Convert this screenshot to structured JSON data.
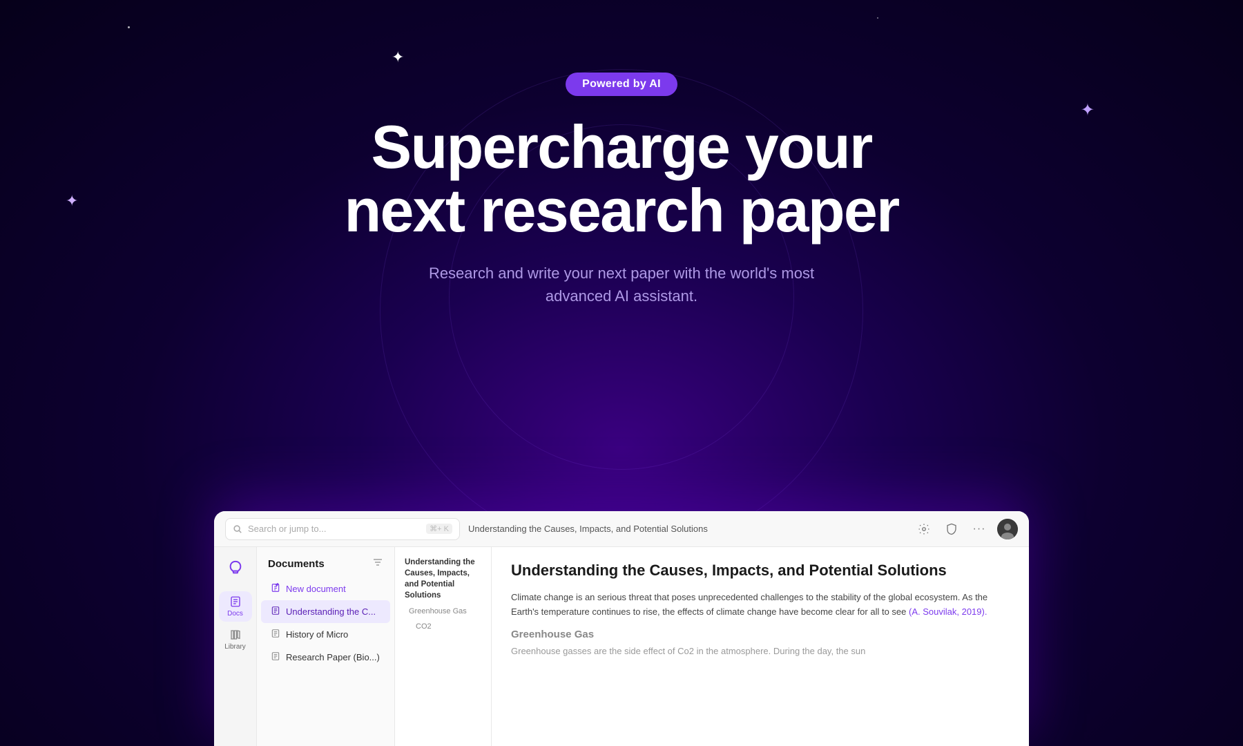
{
  "background": {
    "color": "#0a0020"
  },
  "badge": {
    "label": "Powered by AI"
  },
  "hero": {
    "title_line1": "Supercharge your",
    "title_line2": "next research paper",
    "subtitle": "Research and write your next paper with the world's most advanced AI assistant."
  },
  "topbar": {
    "search_placeholder": "Search or jump to...",
    "search_shortcut": "⌘+ K",
    "breadcrumb": "Understanding the Causes, Impacts, and Potential Solutions"
  },
  "icon_sidebar": {
    "logo_label": "",
    "nav_items": [
      {
        "id": "docs",
        "label": "Docs",
        "active": true
      },
      {
        "id": "library",
        "label": "Library",
        "active": false
      }
    ]
  },
  "doc_sidebar": {
    "title": "Documents",
    "items": [
      {
        "id": "new",
        "name": "New document",
        "type": "new"
      },
      {
        "id": "understanding",
        "name": "Understanding the C...",
        "type": "active"
      },
      {
        "id": "history",
        "name": "History of Micro",
        "type": "normal"
      },
      {
        "id": "research",
        "name": "Research Paper (Bio...)",
        "type": "normal"
      }
    ]
  },
  "outline": {
    "items": [
      {
        "text": "Understanding the Causes, Impacts, and Potential Solutions",
        "level": "main"
      },
      {
        "text": "Greenhouse Gas",
        "level": "sub"
      },
      {
        "text": "CO2",
        "level": "sub2"
      }
    ]
  },
  "content": {
    "title": "Understanding the Causes, Impacts, and Potential Solutions",
    "body": "Climate change is an serious threat that poses unprecedented challenges to the stability of the global ecosystem. As the Earth's temperature continues to rise, the effects of climate change have become clear for all to see",
    "citation": "(A. Souvilak, 2019).",
    "section_title": "Greenhouse Gas",
    "section_body": "Greenhouse gasses are the side effect of Co2 in the atmosphere. During the day, the sun"
  },
  "icons": {
    "settings": "⚙",
    "shield": "🛡",
    "more": "•••",
    "search": "🔍",
    "menu": "≡",
    "doc": "📄",
    "new_doc": "✦",
    "logo": "✏"
  }
}
